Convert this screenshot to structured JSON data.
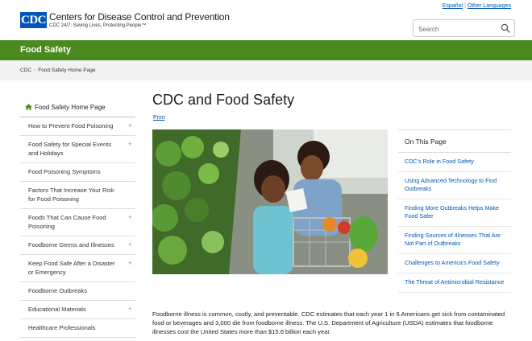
{
  "header": {
    "logo_mark": "CDC",
    "org_name": "Centers for Disease Control and Prevention",
    "tagline": "CDC 24/7: Saving Lives, Protecting People™",
    "lang_espanol": "Español",
    "lang_separator": "|",
    "lang_other": "Other Languages",
    "search_placeholder": "Search",
    "search_icon": "search-icon"
  },
  "section_bar": {
    "title": "Food Safety"
  },
  "breadcrumb": {
    "items": [
      "CDC",
      "Food Safety Home Page"
    ],
    "separator": "›"
  },
  "sidebar": {
    "home": "Food Safety Home Page",
    "items": [
      {
        "label": "How to Prevent Food Poisoning",
        "expand": "+"
      },
      {
        "label": "Food Safety for Special Events and Holidays",
        "expand": "+"
      },
      {
        "label": "Food Poisoning Symptoms",
        "expand": ""
      },
      {
        "label": "Factors That Increase Your Risk for Food Poisoning",
        "expand": ""
      },
      {
        "label": "Foods That Can Cause Food Poisoning",
        "expand": "+"
      },
      {
        "label": "Foodborne Germs and Illnesses",
        "expand": "+"
      },
      {
        "label": "Keep Food Safe After a Disaster or Emergency",
        "expand": "+"
      },
      {
        "label": "Foodborne Outbreaks",
        "expand": ""
      },
      {
        "label": "Educational Materials",
        "expand": "+"
      },
      {
        "label": "Healthcare Professionals",
        "expand": ""
      }
    ]
  },
  "main": {
    "title": "CDC and Food Safety",
    "print_label": "Print",
    "intro": "Foodborne illness is common, costly, and preventable. CDC estimates that each year 1 in 6 Americans get sick from contaminated food or beverages and 3,000 die from foodborne illness. The U.S. Department of Agriculture (USDA) estimates that foodborne illnesses cost the United States more than $15.6 billion each year."
  },
  "on_this_page": {
    "heading": "On This Page",
    "links": [
      "CDC's Role in Food Safety",
      "Using Advanced Technology to Find Outbreaks",
      "Finding More Outbreaks Helps Make Food Safer",
      "Finding Sources of Illnesses That Are Not Part of Outbreaks",
      "Challenges to America's Food Safety",
      "The Threat of Antimicrobial Resistance"
    ]
  },
  "colors": {
    "brand_blue": "#0057b7",
    "section_green": "#4a8a1e",
    "breadcrumb_bg": "#f2f2f2"
  }
}
